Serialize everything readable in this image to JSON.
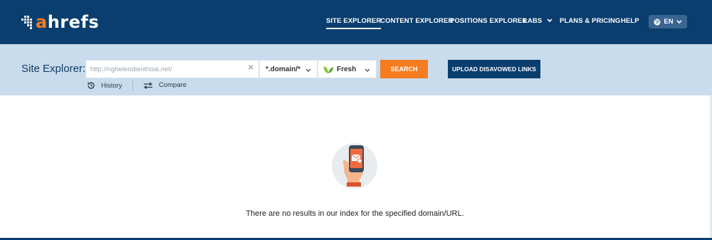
{
  "brand": {
    "logo_prefix": "a",
    "logo_rest": "hrefs",
    "accent": "#f57c21",
    "navy": "#0a3e6e"
  },
  "nav": {
    "items": [
      {
        "label": "SITE EXPLORER",
        "active": true
      },
      {
        "label": "CONTENT EXPLORER"
      },
      {
        "label": "POSITIONS EXPLORER"
      },
      {
        "label": "LABS"
      },
      {
        "label": "PLANS & PRICING"
      },
      {
        "label": "HELP"
      }
    ],
    "lang": "EN"
  },
  "search": {
    "label": "Site Explorer:",
    "url_value": "http://nghelendienthoai.net/",
    "mode": "*.domain/*",
    "index": "Fresh",
    "search_button": "SEARCH",
    "upload_button": "UPLOAD DISAVOWED LINKS",
    "history_label": "History",
    "compare_label": "Compare"
  },
  "main": {
    "empty_message": "There are no results in our index for the specified domain/URL."
  },
  "icons": {
    "logo": "ahrefs-logo-icon",
    "globe": "globe-icon",
    "chevron": "chevron-down-icon",
    "clear": "clear-icon",
    "leaf": "leaf-icon",
    "history": "history-icon",
    "compare": "compare-icon",
    "phone": "phone-hand-icon"
  }
}
